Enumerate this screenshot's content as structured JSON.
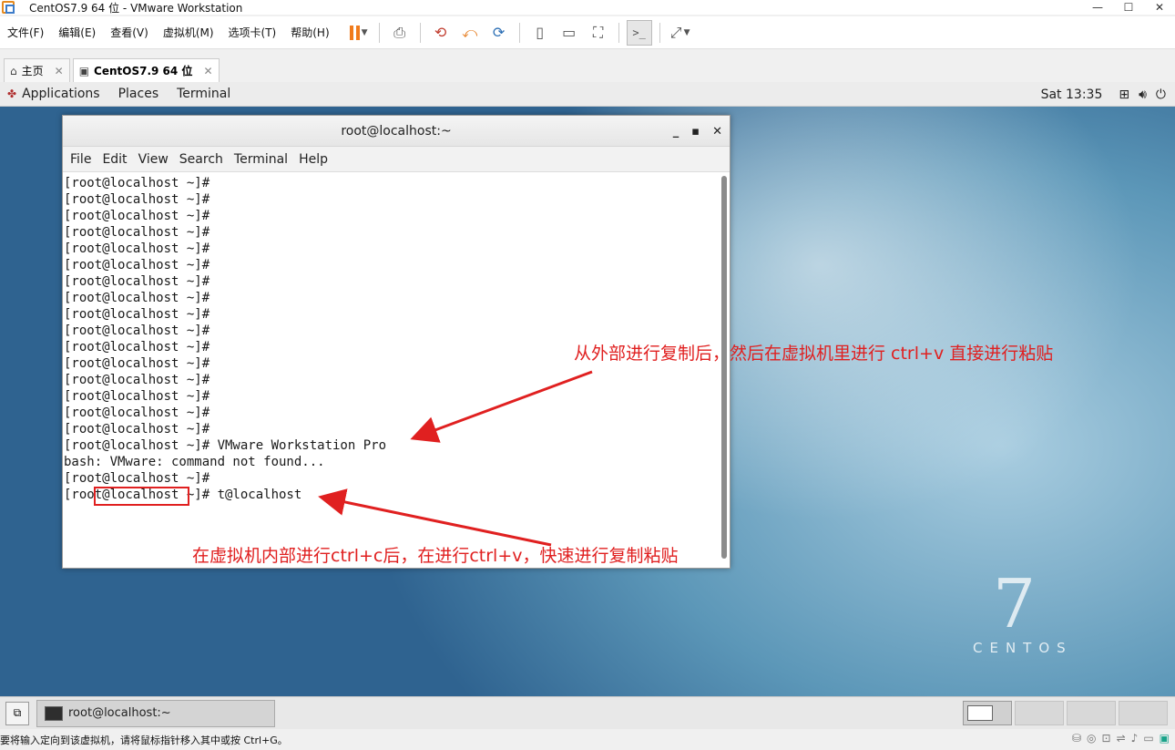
{
  "window": {
    "title": "CentOS7.9 64 位 - VMware Workstation",
    "minimize": "—",
    "maximize": "☐",
    "close": "✕"
  },
  "menubar": {
    "items": [
      "文件(F)",
      "编辑(E)",
      "查看(V)",
      "虚拟机(M)",
      "选项卡(T)",
      "帮助(H)"
    ]
  },
  "tabs": [
    {
      "label": "主页",
      "close": "✕"
    },
    {
      "label": "CentOS7.9 64 位",
      "close": "✕"
    }
  ],
  "gnome": {
    "menus": [
      "Applications",
      "Places",
      "Terminal"
    ],
    "clock": "Sat 13:35"
  },
  "terminal": {
    "title": "root@localhost:~",
    "menus": [
      "File",
      "Edit",
      "View",
      "Search",
      "Terminal",
      "Help"
    ],
    "lines": [
      "[root@localhost ~]#",
      "[root@localhost ~]#",
      "[root@localhost ~]#",
      "[root@localhost ~]#",
      "[root@localhost ~]#",
      "[root@localhost ~]#",
      "[root@localhost ~]#",
      "[root@localhost ~]#",
      "[root@localhost ~]#",
      "[root@localhost ~]#",
      "[root@localhost ~]#",
      "[root@localhost ~]#",
      "[root@localhost ~]#",
      "[root@localhost ~]#",
      "[root@localhost ~]#",
      "[root@localhost ~]#",
      "[root@localhost ~]# VMware Workstation Pro",
      "bash: VMware: command not found...",
      "[root@localhost ~]#",
      "[root@localhost ~]# t@localhost"
    ]
  },
  "annotations": {
    "top": "从外部进行复制后，然后在虚拟机里进行 ctrl+v 直接进行粘贴",
    "bottom": "在虚拟机内部进行ctrl+c后，在进行ctrl+v，快速进行复制粘贴",
    "color": "#e02020"
  },
  "watermark": {
    "number": "7",
    "word": "CENTOS"
  },
  "taskbar": {
    "item": "root@localhost:~"
  },
  "status": {
    "message": "要将输入定向到该虚拟机，请将鼠标指针移入其中或按 Ctrl+G。"
  },
  "icons": {
    "app": "vmware-logo-icon",
    "home": "home-icon",
    "vm_tab": "vm-icon",
    "pause": "pause-icon"
  }
}
